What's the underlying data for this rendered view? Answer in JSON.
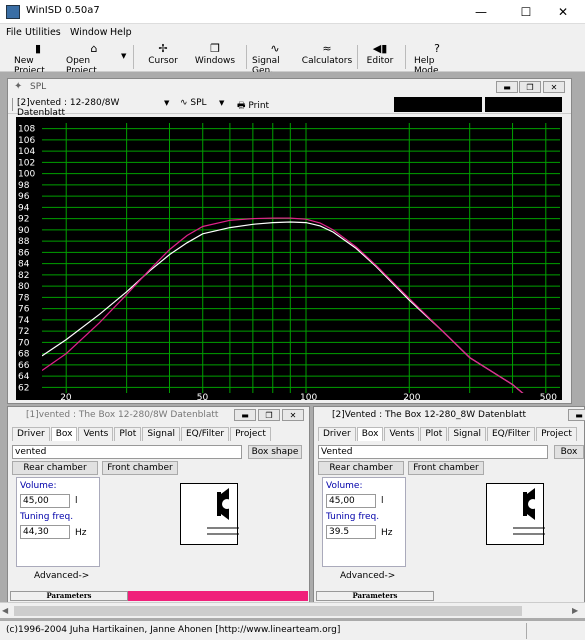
{
  "app": {
    "title": "WinISD 0.50a7",
    "window_buttons": {
      "minimize": "—",
      "maximize": "☐",
      "close": "✕"
    }
  },
  "menu": {
    "file": "File",
    "utilities": "Utilities",
    "window": "Window",
    "help": "Help"
  },
  "toolbar": {
    "new_project": "New Project",
    "open_project": "Open Project",
    "cursor": "Cursor",
    "windows": "Windows",
    "signal_gen": "Signal Gen.",
    "calculators": "Calculators",
    "editor": "Editor",
    "help_mode": "Help Mode"
  },
  "spl_window": {
    "title": "SPL",
    "project_select": "[2]vented : 12-280/8W Datenblatt",
    "graph_type": "SPL",
    "print": "Print",
    "y_ticks": [
      "108",
      "106",
      "104",
      "102",
      "100",
      "98",
      "96",
      "94",
      "92",
      "90",
      "88",
      "86",
      "84",
      "82",
      "80",
      "78",
      "76",
      "74",
      "72",
      "70",
      "68",
      "66",
      "64",
      "62"
    ],
    "x_ticks": [
      "20",
      "50",
      "100",
      "200",
      "500"
    ]
  },
  "chart_data": {
    "type": "line",
    "xscale": "log",
    "xlim": [
      17,
      550
    ],
    "ylim": [
      61,
      109
    ],
    "grid": true,
    "series": [
      {
        "color": "#ffffff",
        "x": [
          17,
          20,
          25,
          30,
          35,
          40,
          45,
          50,
          60,
          70,
          80,
          90,
          100,
          110,
          120,
          140,
          160,
          200,
          250,
          300,
          400,
          500
        ],
        "y": [
          67.6,
          70.5,
          75,
          79,
          82.7,
          85.6,
          87.7,
          89.3,
          90.4,
          91,
          91.3,
          91.4,
          91.3,
          90.7,
          89.6,
          86.7,
          83.5,
          77.5,
          72,
          67.3,
          62.5,
          57.5
        ]
      },
      {
        "color": "#e0208a",
        "x": [
          17,
          20,
          25,
          30,
          35,
          40,
          45,
          50,
          60,
          70,
          80,
          90,
          100,
          110,
          120,
          140,
          160,
          200,
          250,
          300,
          400,
          500
        ],
        "y": [
          65,
          68,
          73.5,
          78.5,
          82.9,
          86.5,
          89,
          90.6,
          91.7,
          92,
          92.1,
          92.1,
          91.9,
          91.2,
          90,
          87,
          83.7,
          77.8,
          72,
          67.3,
          62.5,
          57.5
        ]
      }
    ]
  },
  "box_left": {
    "title": "[1]vented : The Box 12-280/8W Datenblatt",
    "tabs": [
      "Driver",
      "Box",
      "Vents",
      "Plot",
      "Signal",
      "EQ/Filter",
      "Project"
    ],
    "active_tab": "Box",
    "box_name": "vented",
    "box_shape_button": "Box shape",
    "rear_chamber": "Rear chamber",
    "front_chamber": "Front chamber",
    "volume_label": "Volume:",
    "volume_value": "45,00",
    "volume_unit": "l",
    "tuning_label": "Tuning freq.",
    "tuning_value": "44,30",
    "tuning_unit": "Hz",
    "advanced": "Advanced->",
    "params": "Parameters",
    "color": "#f0207a"
  },
  "box_right": {
    "title": "[2]Vented : The Box 12-280_8W Datenblatt",
    "tabs": [
      "Driver",
      "Box",
      "Vents",
      "Plot",
      "Signal",
      "EQ/Filter",
      "Project"
    ],
    "active_tab": "Box",
    "box_name": "Vented",
    "box_shape_button": "Box",
    "rear_chamber": "Rear chamber",
    "front_chamber": "Front chamber",
    "volume_label": "Volume:",
    "volume_value": "45,00",
    "volume_unit": "l",
    "tuning_label": "Tuning freq.",
    "tuning_value": "39.5",
    "tuning_unit": "Hz",
    "advanced": "Advanced->",
    "params": "Parameters"
  },
  "status": {
    "text": "(c)1996-2004 Juha Hartikainen, Janne Ahonen [http://www.linearteam.org]"
  }
}
